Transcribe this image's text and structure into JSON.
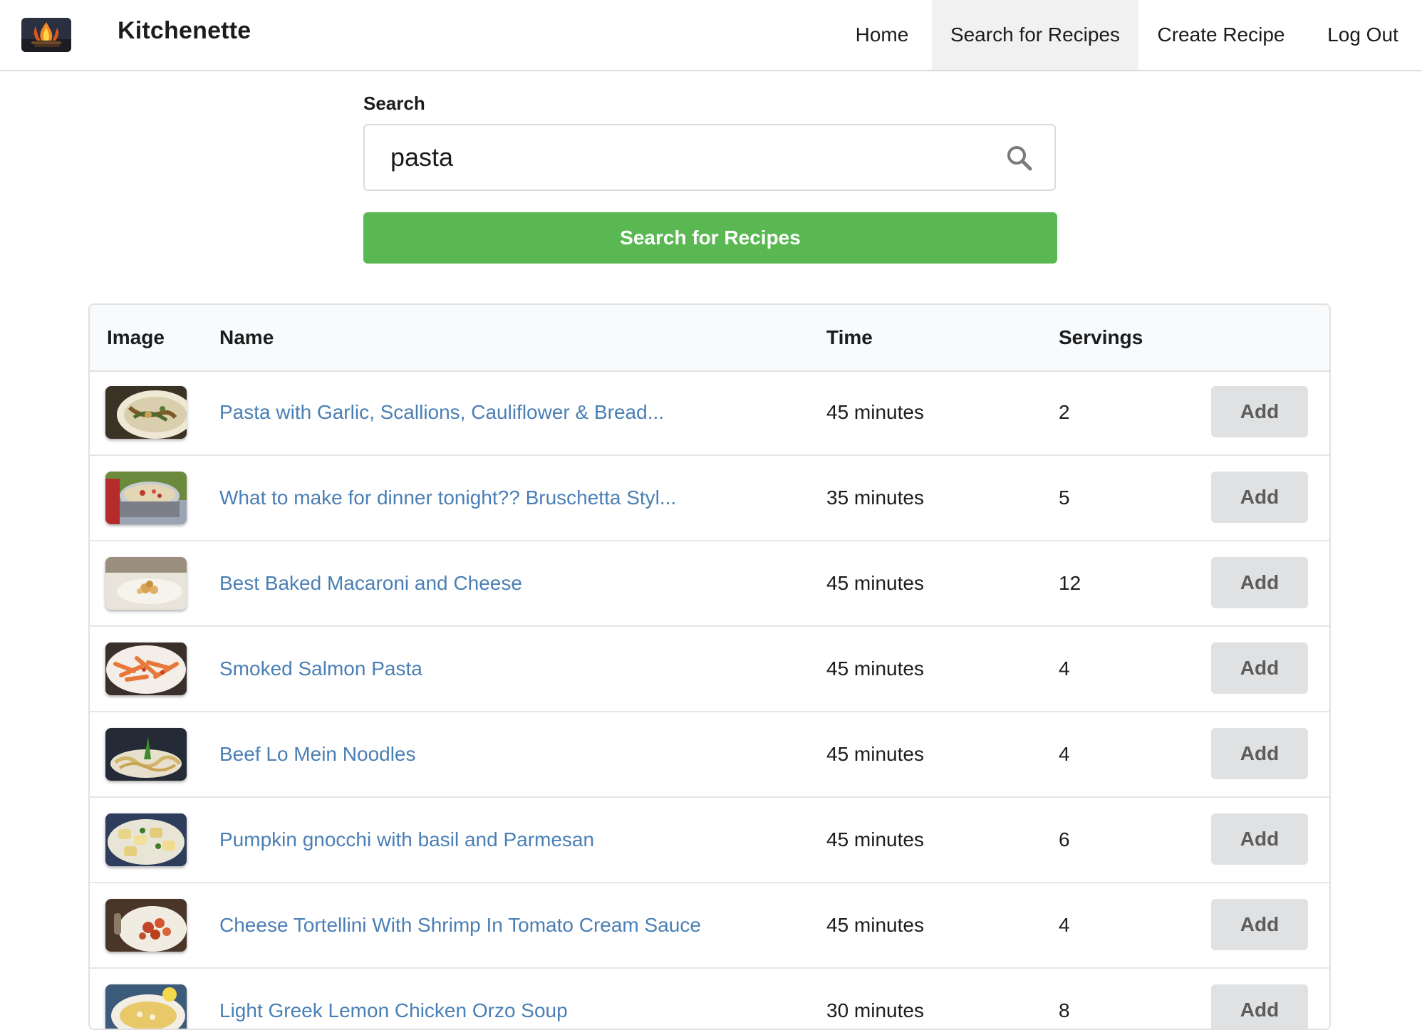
{
  "app": {
    "brand": "Kitchenette",
    "logo_icon": "campfire-logo-icon"
  },
  "nav": {
    "items": [
      {
        "label": "Home",
        "active": false
      },
      {
        "label": "Search for Recipes",
        "active": true
      },
      {
        "label": "Create Recipe",
        "active": false
      },
      {
        "label": "Log Out",
        "active": false
      }
    ]
  },
  "search": {
    "label": "Search",
    "value": "pasta",
    "icon": "search-icon",
    "button_label": "Search for Recipes"
  },
  "colors": {
    "primary_button": "#5ab853",
    "link": "#4a7fb5",
    "add_button_bg": "#e0e1e2",
    "nav_active_bg": "#f1f1f1"
  },
  "table": {
    "columns": [
      "Image",
      "Name",
      "Time",
      "Servings"
    ],
    "rows": [
      {
        "name": "Pasta with Garlic, Scallions, Cauliflower & Bread...",
        "time": "45 minutes",
        "servings": "2",
        "action": "Add",
        "image": "pasta-dish-thumbnail"
      },
      {
        "name": "What to make for dinner tonight?? Bruschetta Styl...",
        "time": "35 minutes",
        "servings": "5",
        "action": "Add",
        "image": "bruschetta-pasta-thumbnail"
      },
      {
        "name": "Best Baked Macaroni and Cheese",
        "time": "45 minutes",
        "servings": "12",
        "action": "Add",
        "image": "mac-and-cheese-thumbnail"
      },
      {
        "name": "Smoked Salmon Pasta",
        "time": "45 minutes",
        "servings": "4",
        "action": "Add",
        "image": "salmon-pasta-thumbnail"
      },
      {
        "name": "Beef Lo Mein Noodles",
        "time": "45 minutes",
        "servings": "4",
        "action": "Add",
        "image": "lo-mein-thumbnail"
      },
      {
        "name": "Pumpkin gnocchi with basil and Parmesan",
        "time": "45 minutes",
        "servings": "6",
        "action": "Add",
        "image": "gnocchi-thumbnail"
      },
      {
        "name": "Cheese Tortellini With Shrimp In Tomato Cream Sauce",
        "time": "45 minutes",
        "servings": "4",
        "action": "Add",
        "image": "tortellini-thumbnail"
      },
      {
        "name": "Light Greek Lemon Chicken Orzo Soup",
        "time": "30 minutes",
        "servings": "8",
        "action": "Add",
        "image": "orzo-soup-thumbnail"
      }
    ]
  }
}
